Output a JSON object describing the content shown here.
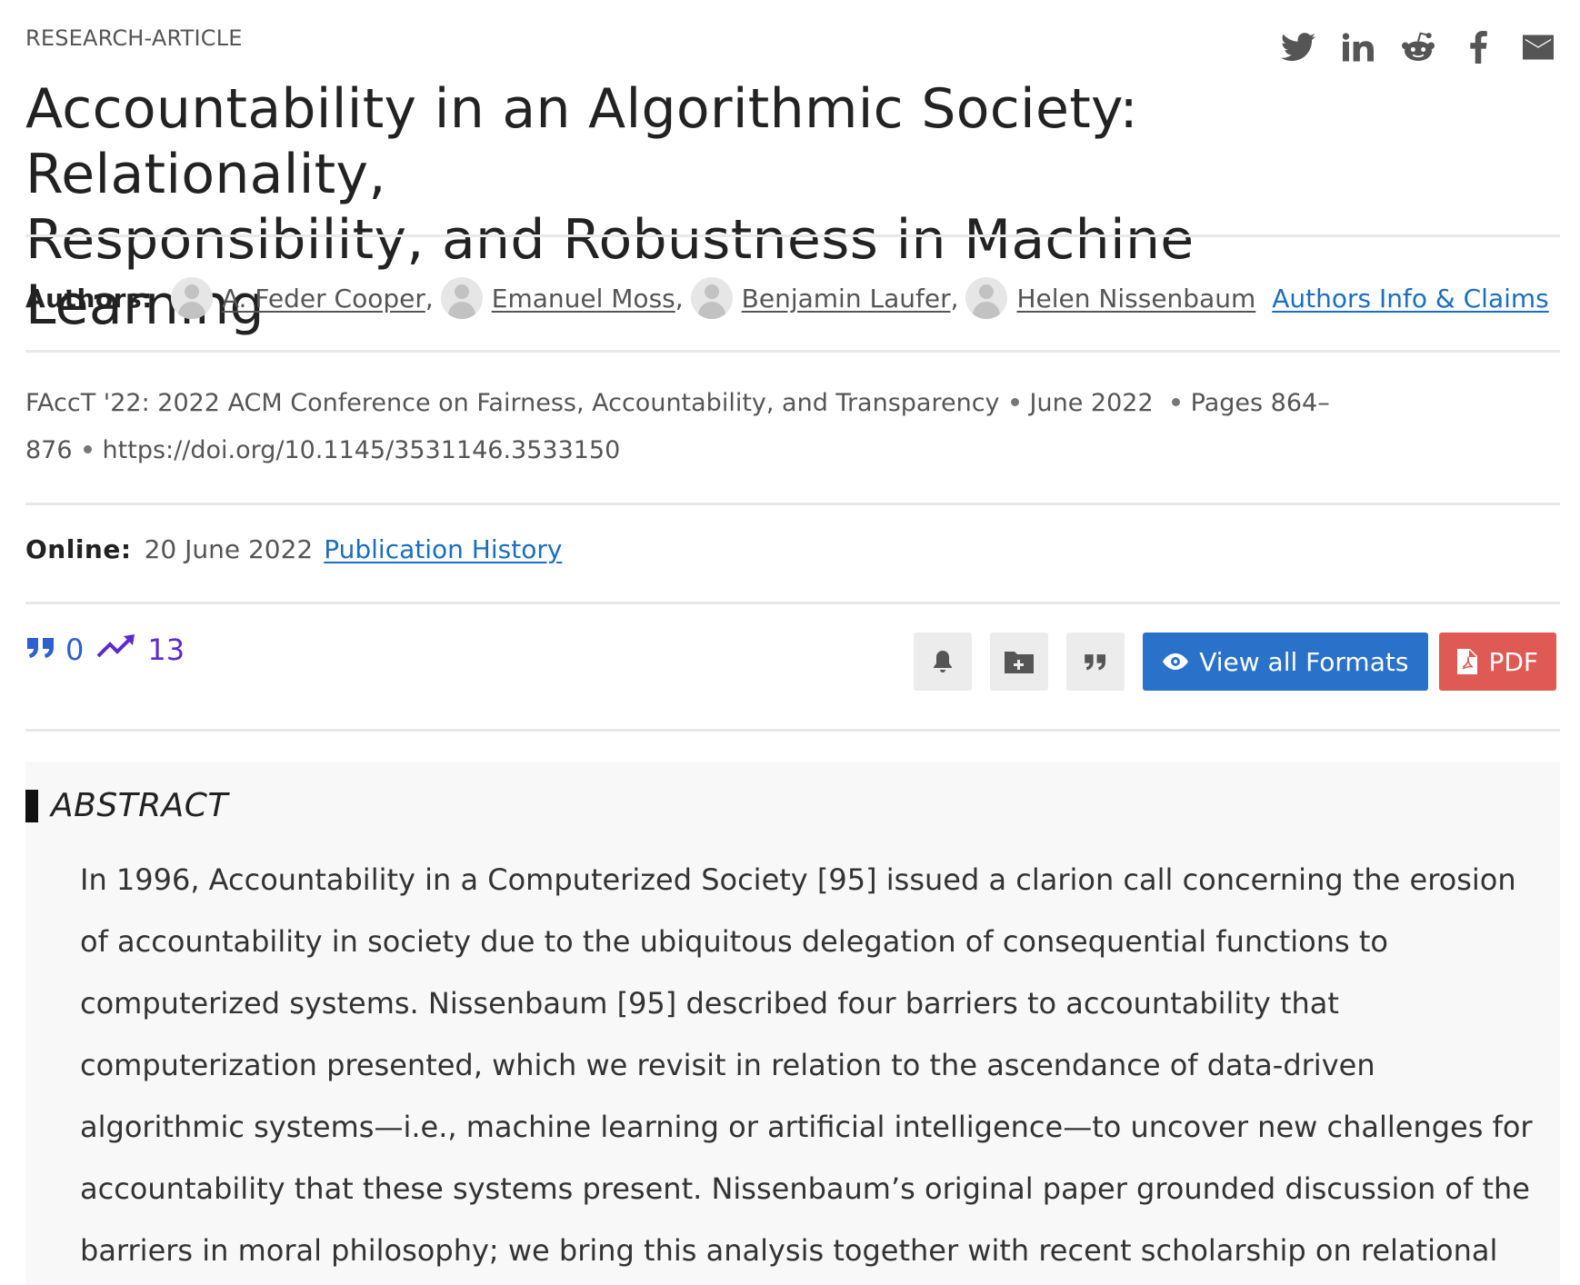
{
  "article_type": "RESEARCH-ARTICLE",
  "share_icons": [
    "twitter-icon",
    "linkedin-icon",
    "reddit-icon",
    "facebook-icon",
    "email-icon"
  ],
  "title_line1": "Accountability in an Algorithmic Society: Relationality,",
  "title_line2": "Responsibility, and Robustness in Machine Learning",
  "authors": {
    "label": "Authors:",
    "list": [
      {
        "name": "A. Feder Cooper",
        "sep": ","
      },
      {
        "name": "Emanuel Moss",
        "sep": ","
      },
      {
        "name": "Benjamin Laufer",
        "sep": ","
      },
      {
        "name": "Helen Nissenbaum",
        "sep": ""
      }
    ],
    "info_link": "Authors Info & Claims"
  },
  "venue": {
    "conference": "FAccT '22: 2022 ACM Conference on Fairness, Accountability, and Transparency",
    "date": "June 2022",
    "pages": "Pages 864–876",
    "pages_part1": "Pages 864–",
    "pages_part2": "876",
    "doi": "https://doi.org/10.1145/3531146.3533150"
  },
  "online": {
    "label": "Online:",
    "date": "20 June 2022",
    "history_link": "Publication History"
  },
  "metrics": {
    "citations": "0",
    "downloads": "13"
  },
  "actions": {
    "formats_label": "View all Formats",
    "pdf_label": "PDF",
    "colors": {
      "formats": "#2a72c9",
      "pdf": "#e05a55",
      "link": "#1a6fc1"
    }
  },
  "abstract": {
    "heading": "ABSTRACT",
    "lines": [
      "In 1996, Accountability in a Computerized Society [95] issued a clarion call concerning the erosion",
      "of accountability in society due to the ubiquitous delegation of consequential functions to",
      "computerized systems. Nissenbaum [95] described four barriers to accountability that",
      "computerization presented, which we revisit in relation to the ascendance of data-driven",
      "algorithmic systems—i.e., machine learning or artificial intelligence—to uncover new challenges for",
      "accountability that these systems present. Nissenbaum’s original paper grounded discussion of the",
      "barriers in moral philosophy; we bring this analysis together with recent scholarship on relational"
    ]
  }
}
